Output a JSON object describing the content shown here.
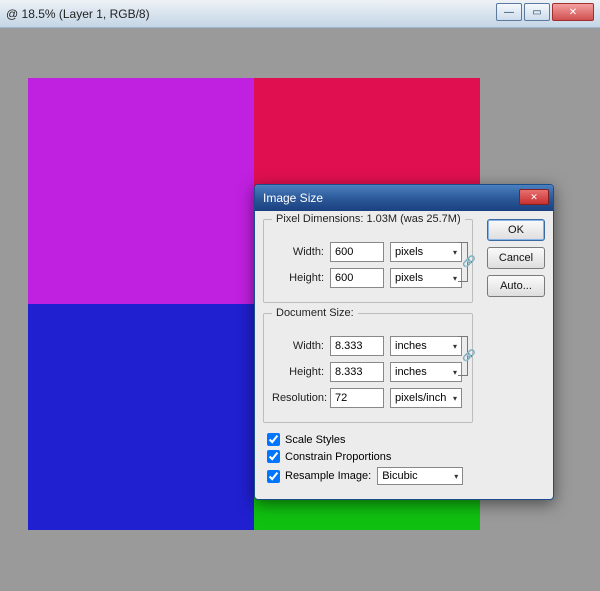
{
  "main": {
    "title": " @ 18.5% (Layer 1, RGB/8)"
  },
  "dialog": {
    "title": "Image Size",
    "pixel_dim": {
      "legend": "Pixel Dimensions:  1.03M (was 25.7M)",
      "width_label": "Width:",
      "width_value": "600",
      "width_unit": "pixels",
      "height_label": "Height:",
      "height_value": "600",
      "height_unit": "pixels"
    },
    "doc_size": {
      "legend": "Document Size:",
      "width_label": "Width:",
      "width_value": "8.333",
      "width_unit": "inches",
      "height_label": "Height:",
      "height_value": "8.333",
      "height_unit": "inches",
      "res_label": "Resolution:",
      "res_value": "72",
      "res_unit": "pixels/inch"
    },
    "checks": {
      "scale": "Scale Styles",
      "constrain": "Constrain Proportions",
      "resample": "Resample Image:",
      "resample_method": "Bicubic"
    },
    "buttons": {
      "ok": "OK",
      "cancel": "Cancel",
      "auto": "Auto..."
    }
  }
}
